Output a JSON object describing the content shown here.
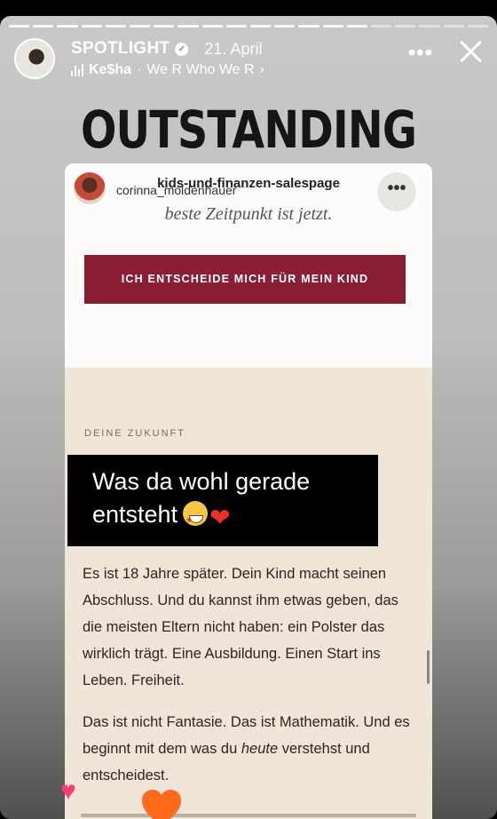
{
  "story": {
    "progress_total": 20,
    "progress_done": 15,
    "username": "SPOTLIGHT",
    "verified_icon": "verified-check-icon",
    "date": "21. April",
    "music": {
      "artist": "Ke$ha",
      "separator": "·",
      "song": "We R Who We R",
      "chevron": "›"
    },
    "more_label": "•••",
    "close_icon": "close-icon"
  },
  "sticker": {
    "title": "OUTSTANDING"
  },
  "inner": {
    "username": "corinna_moldenhauer",
    "url": "kids-und-finanzen-salespage",
    "more_label": "•••",
    "faded_line": "beste Zeitpunkt ist jetzt.",
    "cta_label": "ICH ENTSCHEIDE MICH FÜR MEIN KIND",
    "section_label": "DEINE ZUKUNFT",
    "para1": "Es ist 18 Jahre später. Dein Kind macht seinen Abschluss. Und du kannst ihm etwas geben, das die meisten Eltern nicht haben: ein Polster das wirklich trägt. Eine Ausbildung. Einen Start ins Leben. Freiheit.",
    "para2_a": "Das ist nicht Fantasie. Das ist Mathematik. Und es beginnt mit dem was du ",
    "para2_em": "heute",
    "para2_b": " verstehst und entscheidest."
  },
  "caption": {
    "line1": "Was da wohl gerade",
    "line2": "entsteht",
    "emoji1": "star-struck-emoji",
    "emoji2": "heart-on-fire-emoji"
  },
  "reactions": {
    "pink": "♥",
    "pink_icon": "pink-heart-icon",
    "orange_icon": "orange-heart-icon"
  },
  "colors": {
    "cta": "#8a1e36",
    "card_bg": "#f1e4d8",
    "heart_pink": "#ff3a78",
    "heart_orange": "#ff6a1a"
  }
}
